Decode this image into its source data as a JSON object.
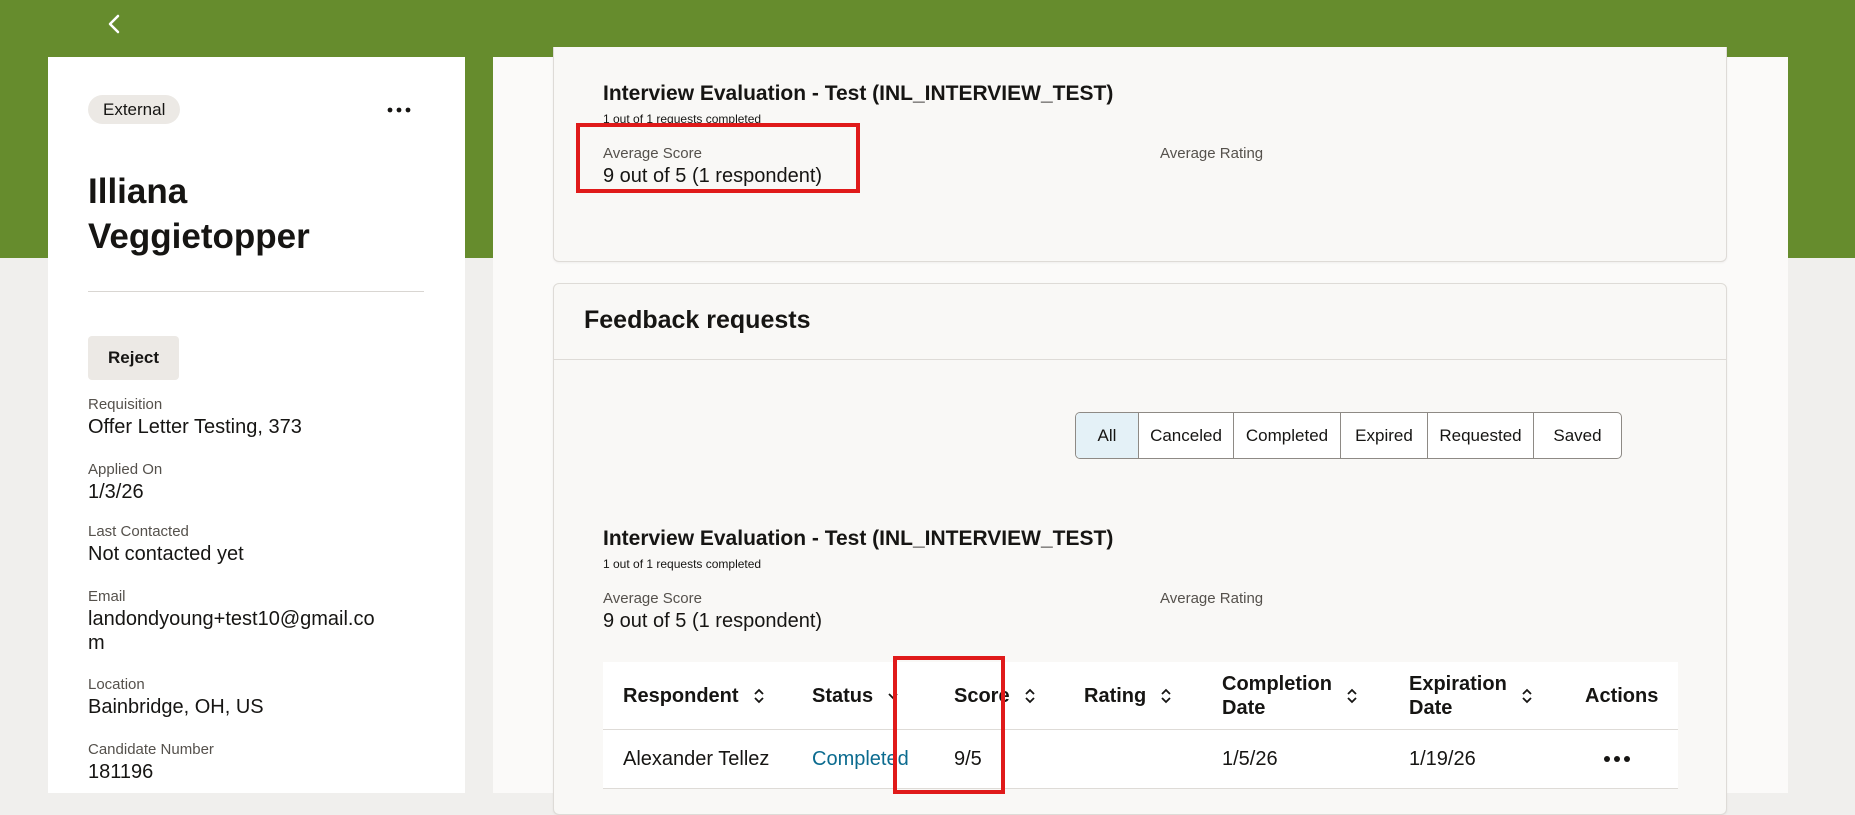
{
  "nav": {
    "back_icon": "chevron-left-icon"
  },
  "candidate": {
    "badge": "External",
    "more_icon": "more-horizontal-icon",
    "name": "Illiana Veggietopper",
    "reject_label": "Reject",
    "fields": {
      "requisition_label": "Requisition",
      "requisition_value": "Offer Letter Testing, 373",
      "applied_label": "Applied On",
      "applied_value": "1/3/26",
      "contacted_label": "Last Contacted",
      "contacted_value": "Not contacted yet",
      "email_label": "Email",
      "email_value": "landondyoung+test10@gmail.com",
      "location_label": "Location",
      "location_value": "Bainbridge, OH, US",
      "number_label": "Candidate Number",
      "number_value": "181196"
    }
  },
  "summary": {
    "title": "Interview Evaluation - Test (INL_INTERVIEW_TEST)",
    "subtitle": "1 out of 1 requests completed",
    "avg_score_label": "Average Score",
    "avg_score_value": "9 out of 5 (1 respondent)",
    "avg_rating_label": "Average Rating"
  },
  "feedback": {
    "title": "Feedback requests",
    "filters": [
      "All",
      "Canceled",
      "Completed",
      "Expired",
      "Requested",
      "Saved"
    ],
    "active_filter": "All",
    "eval": {
      "title": "Interview Evaluation - Test (INL_INTERVIEW_TEST)",
      "subtitle": "1 out of 1 requests completed",
      "avg_score_label": "Average Score",
      "avg_score_value": "9 out of 5 (1 respondent)",
      "avg_rating_label": "Average Rating"
    },
    "table": {
      "headers": {
        "respondent": "Respondent",
        "status": "Status",
        "score": "Score",
        "rating": "Rating",
        "completion_1": "Completion",
        "completion_2": "Date",
        "expiration_1": "Expiration",
        "expiration_2": "Date",
        "actions": "Actions"
      },
      "rows": [
        {
          "respondent": "Alexander Tellez",
          "status": "Completed",
          "score": "9/5",
          "rating": "",
          "completion_date": "1/5/26",
          "expiration_date": "1/19/26",
          "actions_icon": "more-horizontal-icon"
        }
      ]
    }
  },
  "colors": {
    "brand_band": "#668c2d",
    "highlight": "#e01a1a",
    "link": "#0b6b8f",
    "active_filter_bg": "#e4f1f7"
  }
}
